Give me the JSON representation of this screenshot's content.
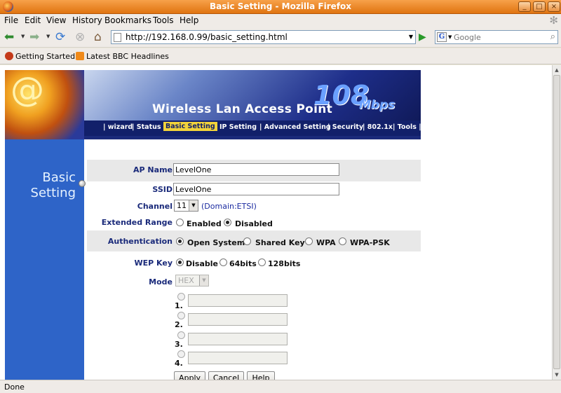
{
  "window": {
    "title": "Basic Setting - Mozilla Firefox",
    "buttons": [
      "_",
      "□",
      "×"
    ]
  },
  "menu": [
    "File",
    "Edit",
    "View",
    "History",
    "Bookmarks",
    "Tools",
    "Help"
  ],
  "toolbar": {
    "url": "http://192.168.0.99/basic_setting.html",
    "search_placeholder": "Google",
    "search_engine_letter": "G"
  },
  "bookmarks": [
    "Getting Started",
    "Latest BBC Headlines"
  ],
  "banner": {
    "logo_char": "@",
    "product": "Wireless Lan Access Point",
    "speed": "108",
    "speed_unit": "Mbps",
    "nav": [
      "| wizard",
      "| Status",
      "Basic  Setting",
      "IP Setting",
      "| Advanced Setting",
      "| Security",
      "| 802.1x",
      "| Tools |"
    ]
  },
  "sidebar": {
    "line1": "Basic",
    "line2": "Setting"
  },
  "form": {
    "ap_name_label": "AP Name",
    "ap_name_value": "LevelOne",
    "ssid_label": "SSID",
    "ssid_value": "LevelOne",
    "channel_label": "Channel",
    "channel_value": "11",
    "domain": "(Domain:ETSI)",
    "extended_range_label": "Extended Range",
    "extended_range_options": [
      "Enabled",
      "Disabled"
    ],
    "extended_range_selected": "Disabled",
    "authentication_label": "Authentication",
    "authentication_options": [
      "Open System",
      "Shared Key",
      "WPA",
      "WPA-PSK"
    ],
    "authentication_selected": "Open System",
    "wep_key_label": "WEP Key",
    "wep_key_options": [
      "Disable",
      "64bits",
      "128bits"
    ],
    "wep_key_selected": "Disable",
    "mode_label": "Mode",
    "mode_value": "HEX",
    "key_numbers": [
      "1.",
      "2.",
      "3.",
      "4."
    ],
    "buttons": [
      "Apply",
      "Cancel",
      "Help"
    ]
  },
  "status": "Done"
}
